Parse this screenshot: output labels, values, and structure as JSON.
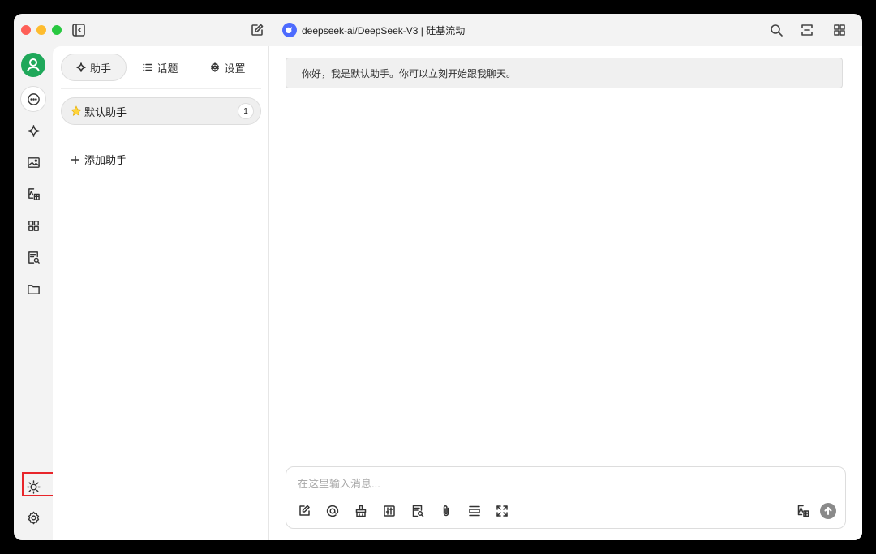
{
  "titlebar": {
    "model_title": "deepseek-ai/DeepSeek-V3 | 硅基流动",
    "icons": [
      "sidebar-toggle-icon",
      "new-chat-icon",
      "search-icon",
      "expand-icon",
      "grid-icon"
    ]
  },
  "rail": {
    "items": [
      "chat-icon",
      "sparkle-icon",
      "image-icon",
      "translate-icon",
      "apps-icon",
      "doc-search-icon",
      "folder-icon"
    ],
    "bottom": [
      "theme-sun-icon",
      "settings-gear-icon"
    ]
  },
  "sidebar": {
    "tabs": [
      {
        "label": "助手",
        "icon": "sparkle-icon"
      },
      {
        "label": "话题",
        "icon": "list-icon"
      },
      {
        "label": "设置",
        "icon": "gear-icon"
      }
    ],
    "assistant": {
      "label": "默认助手",
      "icon": "star-icon",
      "count": "1"
    },
    "add_label": "添加助手"
  },
  "main": {
    "welcome": "你好，我是默认助手。你可以立刻开始跟我聊天。",
    "composer": {
      "placeholder": "在这里输入消息...",
      "tools": [
        "edit-icon",
        "at-icon",
        "clean-icon",
        "sliders-icon",
        "doc-search-icon",
        "paperclip-icon",
        "collapse-icon",
        "fullscreen-icon",
        "translate-icon",
        "send-icon"
      ]
    }
  },
  "colors": {
    "accent_green": "#1fa85a",
    "highlight_red": "#e8252a",
    "deepseek_blue": "#4d6bfe"
  }
}
